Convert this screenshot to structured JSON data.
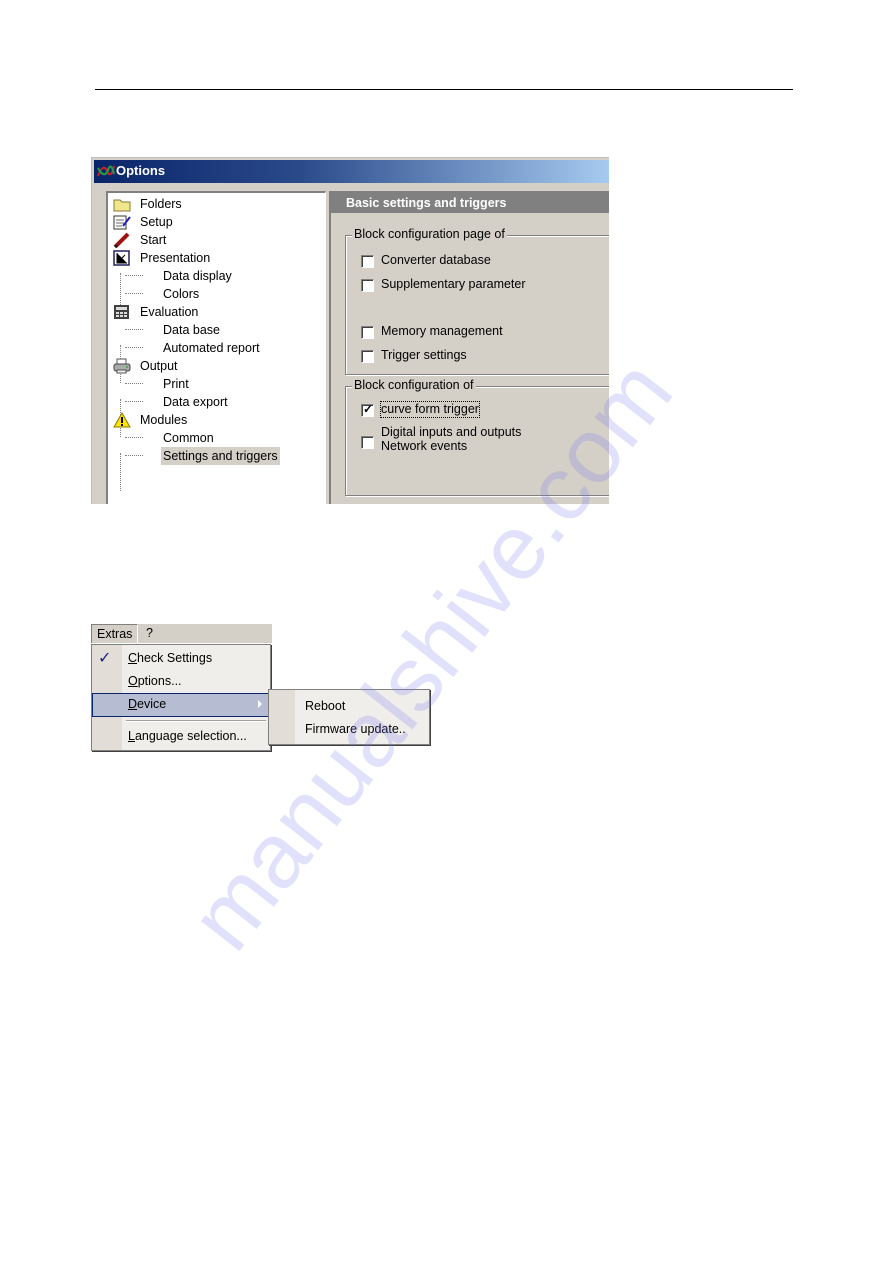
{
  "options_dialog": {
    "title": "Options",
    "tree": [
      {
        "label": "Folders",
        "icon": "folder-icon",
        "level": 0
      },
      {
        "label": "Setup",
        "icon": "notepad-pen-icon",
        "level": 0
      },
      {
        "label": "Start",
        "icon": "pen-icon",
        "level": 0
      },
      {
        "label": "Presentation",
        "icon": "chart-axes-icon",
        "level": 0
      },
      {
        "label": "Data display",
        "level": 1
      },
      {
        "label": "Colors",
        "level": 1
      },
      {
        "label": "Evaluation",
        "icon": "calculator-icon",
        "level": 0
      },
      {
        "label": "Data base",
        "level": 1
      },
      {
        "label": "Automated report",
        "level": 1
      },
      {
        "label": "Output",
        "icon": "printer-icon",
        "level": 0
      },
      {
        "label": "Print",
        "level": 1
      },
      {
        "label": "Data export",
        "level": 1
      },
      {
        "label": "Modules",
        "icon": "warning-icon",
        "level": 0
      },
      {
        "label": "Common",
        "level": 1
      },
      {
        "label": "Settings and triggers",
        "level": 1,
        "selected": true
      }
    ],
    "panel_title": "Basic settings and triggers",
    "group1": {
      "legend": "Block configuration page of",
      "checkboxes": [
        {
          "label": "Converter database",
          "checked": false
        },
        {
          "label": "Supplementary parameter",
          "checked": false
        },
        {
          "label": "Memory management",
          "checked": false
        },
        {
          "label": "Trigger settings",
          "checked": false
        }
      ]
    },
    "group2": {
      "legend": "Block configuration of",
      "checkboxes": [
        {
          "label": "curve form trigger",
          "checked": true,
          "focused": true
        },
        {
          "label_line1": "Digital inputs and outputs",
          "label_line2": "Network events",
          "checked": false
        }
      ]
    }
  },
  "menu_screenshot": {
    "menubar": [
      "Extras",
      "?"
    ],
    "extras_menu": [
      {
        "label": "Check Settings",
        "mnemonic": "C",
        "rest": "heck Settings",
        "checked": true
      },
      {
        "label": "Options...",
        "mnemonic": "O",
        "rest": "ptions..."
      },
      {
        "label": "Device",
        "mnemonic": "D",
        "rest": "evice",
        "submenu": true,
        "highlighted": true
      },
      {
        "label": "Language selection...",
        "mnemonic": "L",
        "rest": "anguage selection..."
      }
    ],
    "device_submenu": [
      "Reboot",
      "Firmware update.."
    ]
  },
  "watermark": "manualshive.com"
}
